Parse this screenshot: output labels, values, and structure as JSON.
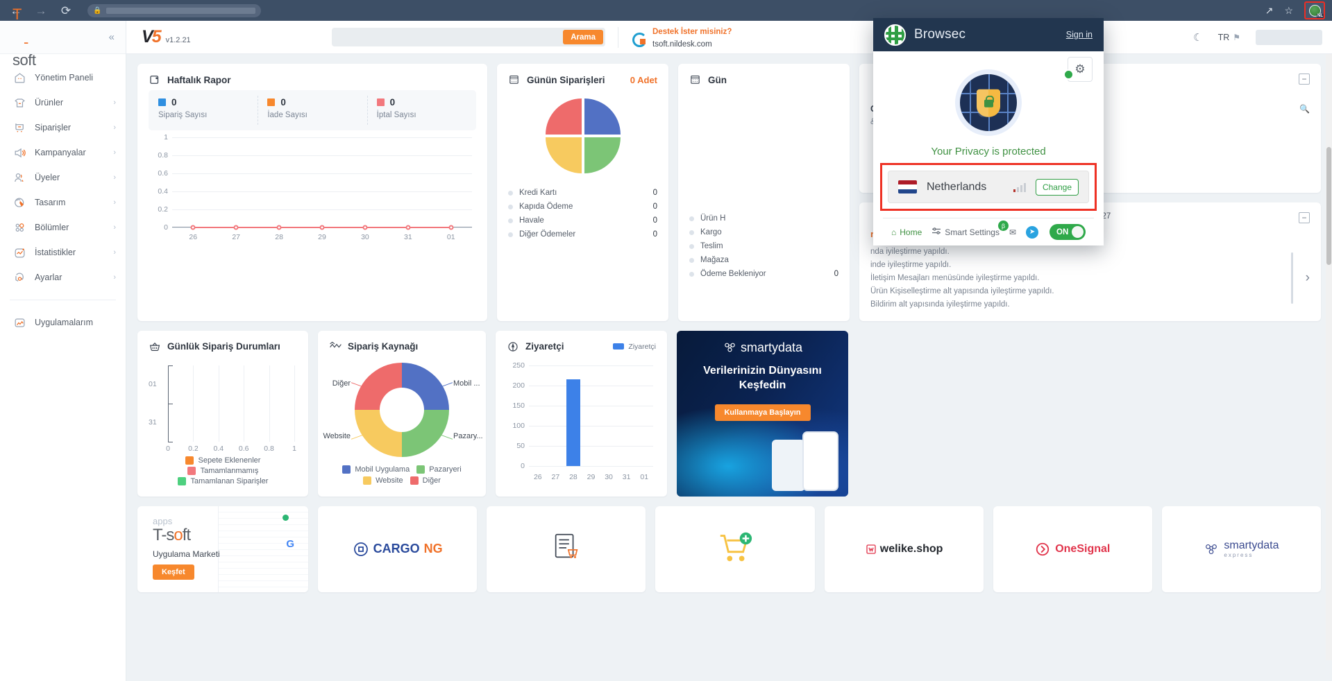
{
  "browser": {
    "back_icon": "back-arrow-icon",
    "forward_icon": "forward-arrow-icon",
    "reload_icon": "reload-icon",
    "lock_icon": "lock-icon",
    "url_value": "",
    "share_icon": "share-icon",
    "bookmark_icon": "star-icon",
    "extension_badge_label": "NL"
  },
  "sidebar": {
    "brand": "T-soft",
    "collapse_icon": "chevron-double-left-icon",
    "items": [
      {
        "label": "Yönetim Paneli",
        "icon": "dashboard-home-icon",
        "arrow": ""
      },
      {
        "label": "Ürünler",
        "icon": "tshirt-product-icon",
        "arrow": "›"
      },
      {
        "label": "Siparişler",
        "icon": "shopping-cart-icon",
        "arrow": "›"
      },
      {
        "label": "Kampanyalar",
        "icon": "megaphone-icon",
        "arrow": "›"
      },
      {
        "label": "Üyeler",
        "icon": "users-icon",
        "arrow": "›"
      },
      {
        "label": "Tasarım",
        "icon": "palette-brush-icon",
        "arrow": "›"
      },
      {
        "label": "Bölümler",
        "icon": "grid-circles-icon",
        "arrow": "›"
      },
      {
        "label": "İstatistikler",
        "icon": "chart-line-icon",
        "arrow": "›"
      },
      {
        "label": "Ayarlar",
        "icon": "gear-icon",
        "arrow": "›"
      }
    ],
    "apps_item": {
      "label": "Uygulamalarım",
      "icon": "apps-grid-icon"
    }
  },
  "topbar": {
    "logo_text": "V5",
    "version": "v1.2.21",
    "search_placeholder": "",
    "search_value": "",
    "search_button": "Arama",
    "support_line1": "Destek İster misiniz?",
    "support_line2": "tsoft.nildesk.com",
    "support_icon": "lifebuoy-support-icon",
    "dark_mode_icon": "moon-icon",
    "language": "TR",
    "language_flag_icon": "flag-icon",
    "user_avatar": "user-avatar-placeholder"
  },
  "cards": {
    "weekly_report": {
      "title": "Haftalık Rapor",
      "icon": "wallet-icon",
      "stats": [
        {
          "value": "0",
          "label": "Sipariş Sayısı",
          "color": "#2f8fe0"
        },
        {
          "value": "0",
          "label": "İade Sayısı",
          "color": "#f7882d"
        },
        {
          "value": "0",
          "label": "İptal Sayısı",
          "color": "#f2787d"
        }
      ]
    },
    "daily_orders": {
      "title": "Günün Siparişleri",
      "icon": "calendar-icon",
      "count_label": "0 Adet",
      "rows": [
        {
          "label": "Kredi Kartı",
          "value": "0"
        },
        {
          "label": "Kapıda Ödeme",
          "value": "0"
        },
        {
          "label": "Havale",
          "value": "0"
        },
        {
          "label": "Diğer Ödemeler",
          "value": "0"
        }
      ]
    },
    "daily_status": {
      "title": "Gün",
      "icon": "calendar-icon",
      "rows": [
        {
          "label": "Ürün H",
          "value": ""
        },
        {
          "label": "Kargo",
          "value": ""
        },
        {
          "label": "Teslim",
          "value": ""
        },
        {
          "label": "Mağaza",
          "value": ""
        },
        {
          "label": "Ödeme Bekleniyor",
          "value": "0"
        }
      ]
    },
    "notice": {
      "title_fragment": "Geçti",
      "body_fragment": "&nbsp;Sms ayarlarımız yeni yüzüne ka...",
      "search_icon": "search-icon",
      "minimize_icon": "minimize-icon"
    },
    "updates": {
      "version_label": "Versiyon : 5.0.27",
      "minimize_icon": "minimize-icon",
      "title_fragment": "rı (22.05.2023)",
      "lines": [
        "nda iyileştirme yapıldı.",
        "inde iyileştirme yapıldı.",
        "İletişim Mesajları menüsünde iyileştirme yapıldı.",
        "Ürün Kişiselleştirme alt yapısında iyileştirme yapıldı.",
        "Bildirim alt yapısında iyileştirme yapıldı."
      ],
      "next_icon": "chevron-right-icon"
    },
    "order_status": {
      "title": "Günlük Sipariş Durumları",
      "icon": "basket-icon"
    },
    "order_source": {
      "title": "Sipariş Kaynağı",
      "icon": "zigzag-icon"
    },
    "visitors": {
      "title": "Ziyaretçi",
      "icon": "compass-icon",
      "legend": "Ziyaretçi"
    },
    "banner": {
      "brand": "smartydata",
      "brand_icon": "smartydata-logo-icon",
      "headline_1": "Verilerinizin Dünyasını",
      "headline_2": "Keşfedin",
      "cta": "Kullanmaya Başlayın"
    }
  },
  "chart_data": [
    {
      "type": "line",
      "title": "Haftalık Rapor",
      "x": [
        "26",
        "27",
        "28",
        "29",
        "30",
        "31",
        "01"
      ],
      "series": [
        {
          "name": "Sipariş Sayısı",
          "color": "#2f8fe0",
          "values": [
            0,
            0,
            0,
            0,
            0,
            0,
            0
          ]
        },
        {
          "name": "İade Sayısı",
          "color": "#f7882d",
          "values": [
            0,
            0,
            0,
            0,
            0,
            0,
            0
          ]
        },
        {
          "name": "İptal Sayısı",
          "color": "#f2787d",
          "values": [
            0,
            0,
            0,
            0,
            0,
            0,
            0
          ]
        }
      ],
      "ylim": [
        0,
        1
      ],
      "yticks": [
        "0",
        "0.2",
        "0.4",
        "0.6",
        "0.8",
        "1"
      ],
      "grid": true,
      "legend": "none"
    },
    {
      "type": "pie",
      "title": "Günün Siparişleri",
      "categories": [
        "Kredi Kartı",
        "Kapıda Ödeme",
        "Havale",
        "Diğer Ödemeler"
      ],
      "values": [
        0,
        0,
        0,
        0
      ],
      "slice_shares": [
        25,
        25,
        25,
        25
      ],
      "colors": [
        "#5271c4",
        "#7cc576",
        "#f7ca5f",
        "#ee6b6b"
      ],
      "legend": "bottom-list"
    },
    {
      "type": "bar",
      "title": "Günlük Sipariş Durumları",
      "orientation": "horizontal",
      "categories": [
        "01",
        "31"
      ],
      "series": [
        {
          "name": "Sepete Eklenenler",
          "color": "#f7882d",
          "values": [
            0,
            0
          ]
        },
        {
          "name": "Tamamlanmamış",
          "color": "#f2787d",
          "values": [
            0,
            0
          ]
        },
        {
          "name": "Tamamlanan Siparişler",
          "color": "#4ed07f",
          "values": [
            0,
            0
          ]
        }
      ],
      "xticks": [
        "0",
        "0.2",
        "0.4",
        "0.6",
        "0.8",
        "1"
      ],
      "xlim": [
        0,
        1
      ],
      "grid": true,
      "legend": "bottom"
    },
    {
      "type": "pie",
      "subtype": "donut",
      "title": "Sipariş Kaynağı",
      "categories": [
        "Mobil Uygulama",
        "Pazaryeri",
        "Website",
        "Diğer"
      ],
      "slice_shares": [
        25,
        25,
        25,
        25
      ],
      "colors": [
        "#5271c4",
        "#7cc576",
        "#f7ca5f",
        "#ee6b6b"
      ],
      "callout_labels": [
        "Mobil ...",
        "Pazary...",
        "Website",
        "Diğer"
      ],
      "legend": "bottom"
    },
    {
      "type": "bar",
      "title": "Ziyaretçi",
      "categories": [
        "26",
        "27",
        "28",
        "29",
        "30",
        "31",
        "01"
      ],
      "values": [
        0,
        0,
        215,
        0,
        0,
        0,
        0
      ],
      "colors": [
        "#3d81e8"
      ],
      "ylim": [
        0,
        250
      ],
      "yticks": [
        "0",
        "50",
        "100",
        "150",
        "200",
        "250"
      ],
      "grid": true,
      "legend": "top-right",
      "legend_entries": [
        "Ziyaretçi"
      ]
    }
  ],
  "tiles": [
    {
      "name": "apps-market",
      "apps_label": "apps",
      "logo": "T-soft",
      "sub": "Uygulama Marketi",
      "cta": "Keşfet"
    },
    {
      "name": "cargo-ng",
      "label": "CARGO",
      "label2": "NG"
    },
    {
      "name": "order-form",
      "label": ""
    },
    {
      "name": "cart-plus",
      "label": ""
    },
    {
      "name": "welike-shop",
      "label": "welike.shop"
    },
    {
      "name": "onesignal",
      "label": "OneSignal"
    },
    {
      "name": "smartydata-express",
      "label": "smartydata",
      "sub": "express"
    }
  ],
  "popup": {
    "brand": "Browsec",
    "globe_icon": "globe-icon",
    "sign_in": "Sign in",
    "gear_icon": "gear-icon",
    "status_text": "Your Privacy is protected",
    "country": "Netherlands",
    "country_flag_icon": "netherlands-flag-icon",
    "signal_icon": "signal-bars-icon",
    "change_button": "Change",
    "footer": {
      "home": "Home",
      "home_icon": "home-icon",
      "smart_settings": "Smart Settings",
      "smart_settings_icon": "sliders-icon",
      "beta_badge": "β",
      "mail_icon": "envelope-icon",
      "telegram_icon": "telegram-icon",
      "toggle_label": "ON"
    }
  }
}
